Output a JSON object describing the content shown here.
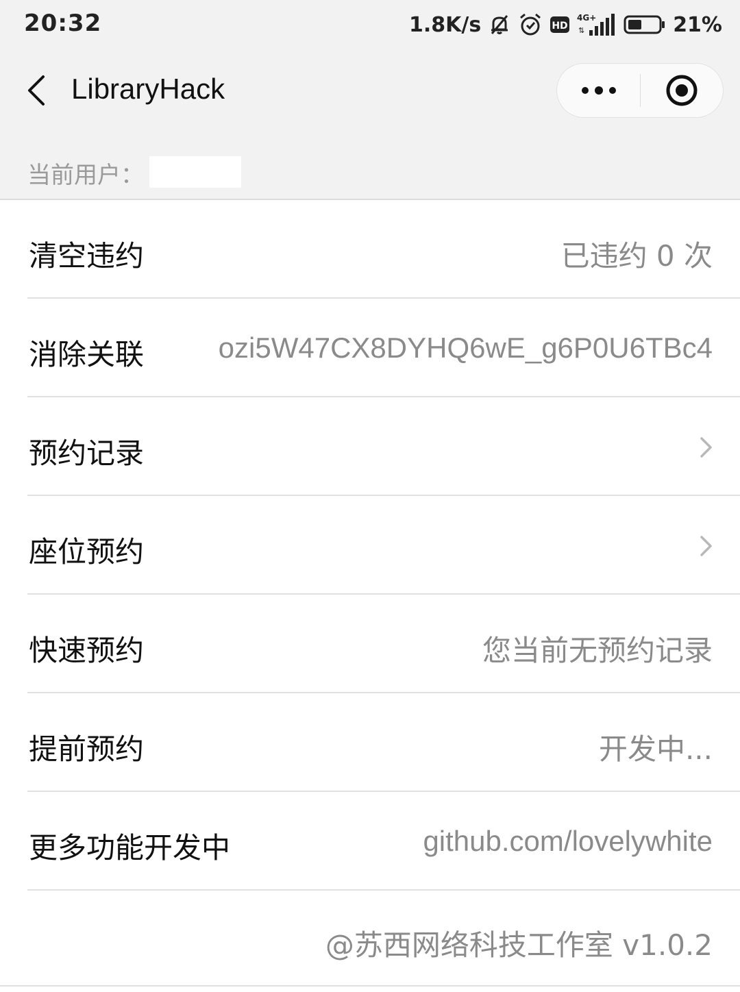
{
  "status_bar": {
    "time": "20:32",
    "network_speed": "1.8K/s",
    "battery_percent": "21%",
    "network_type": "4G+",
    "hd_label": "HD",
    "icons": [
      "mute-bell-icon",
      "alarm-icon",
      "hd-icon",
      "signal-icon",
      "battery-icon"
    ],
    "battery_level": 0.21
  },
  "nav": {
    "title": "LibraryHack",
    "back_icon": "chevron-left-icon",
    "more_icon": "more-dots-icon",
    "close_icon": "record-circle-icon"
  },
  "user": {
    "label": "当前用户：",
    "value": ""
  },
  "cells": [
    {
      "title": "清空违约",
      "value": "已违约 0 次",
      "arrow": false
    },
    {
      "title": "消除关联",
      "value": "ozi5W47CX8DYHQ6wE_g6P0U6TBc4",
      "arrow": false
    },
    {
      "title": "预约记录",
      "value": "",
      "arrow": true
    },
    {
      "title": "座位预约",
      "value": "",
      "arrow": true
    },
    {
      "title": "快速预约",
      "value": "您当前无预约记录",
      "arrow": false
    },
    {
      "title": "提前预约",
      "value": "开发中...",
      "arrow": false
    },
    {
      "title": "更多功能开发中",
      "value": "github.com/lovelywhite",
      "arrow": false
    }
  ],
  "footer": {
    "text": "@苏西网络科技工作室 v1.0.2"
  },
  "colors": {
    "background": "#f2f2f2",
    "list_background": "#ffffff",
    "primary_text": "#111111",
    "secondary_text": "#8a8a8a",
    "separator": "#e0e0e0"
  }
}
